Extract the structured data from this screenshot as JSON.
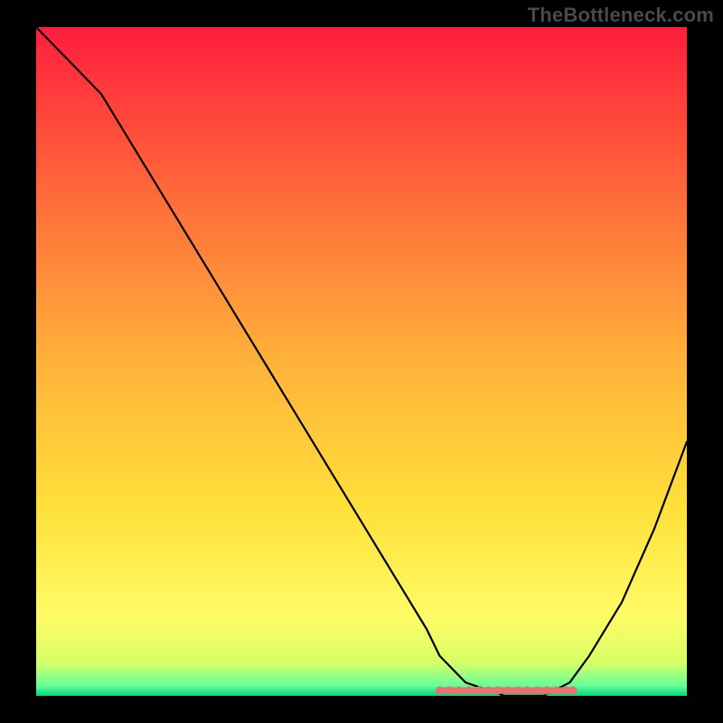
{
  "watermark": "TheBottleneck.com",
  "chart_data": {
    "type": "line",
    "title": "",
    "xlabel": "",
    "ylabel": "",
    "xlim": [
      0,
      100
    ],
    "ylim": [
      0,
      100
    ],
    "grid": false,
    "legend": false,
    "background_gradient": {
      "stops": [
        {
          "offset": 0.0,
          "color": "#ff1e3c"
        },
        {
          "offset": 0.25,
          "color": "#ff6a3a"
        },
        {
          "offset": 0.5,
          "color": "#ffb23a"
        },
        {
          "offset": 0.72,
          "color": "#ffe03a"
        },
        {
          "offset": 0.88,
          "color": "#fffb66"
        },
        {
          "offset": 0.95,
          "color": "#d8ff66"
        },
        {
          "offset": 0.985,
          "color": "#66ff99"
        },
        {
          "offset": 1.0,
          "color": "#00d47a"
        }
      ]
    },
    "series": [
      {
        "name": "bottleneck-curve",
        "color": "#000000",
        "stroke_width": 2.2,
        "x": [
          0,
          5,
          10,
          15,
          20,
          25,
          30,
          35,
          40,
          45,
          50,
          55,
          60,
          62,
          66,
          72,
          78,
          82,
          85,
          90,
          95,
          100
        ],
        "y": [
          100,
          95,
          90,
          82,
          74,
          66,
          58,
          50,
          42,
          34,
          26,
          18,
          10,
          6,
          2,
          0,
          0,
          2,
          6,
          14,
          25,
          38
        ]
      }
    ],
    "flat_marker": {
      "name": "optimal-range",
      "color": "#e6736e",
      "segments_x": [
        62,
        63.5,
        65,
        66.5,
        68,
        69.5,
        71,
        72.5,
        74,
        75.5,
        77,
        78.5,
        80,
        81.5,
        82.5
      ],
      "y": 0,
      "radius": 4.6
    }
  }
}
